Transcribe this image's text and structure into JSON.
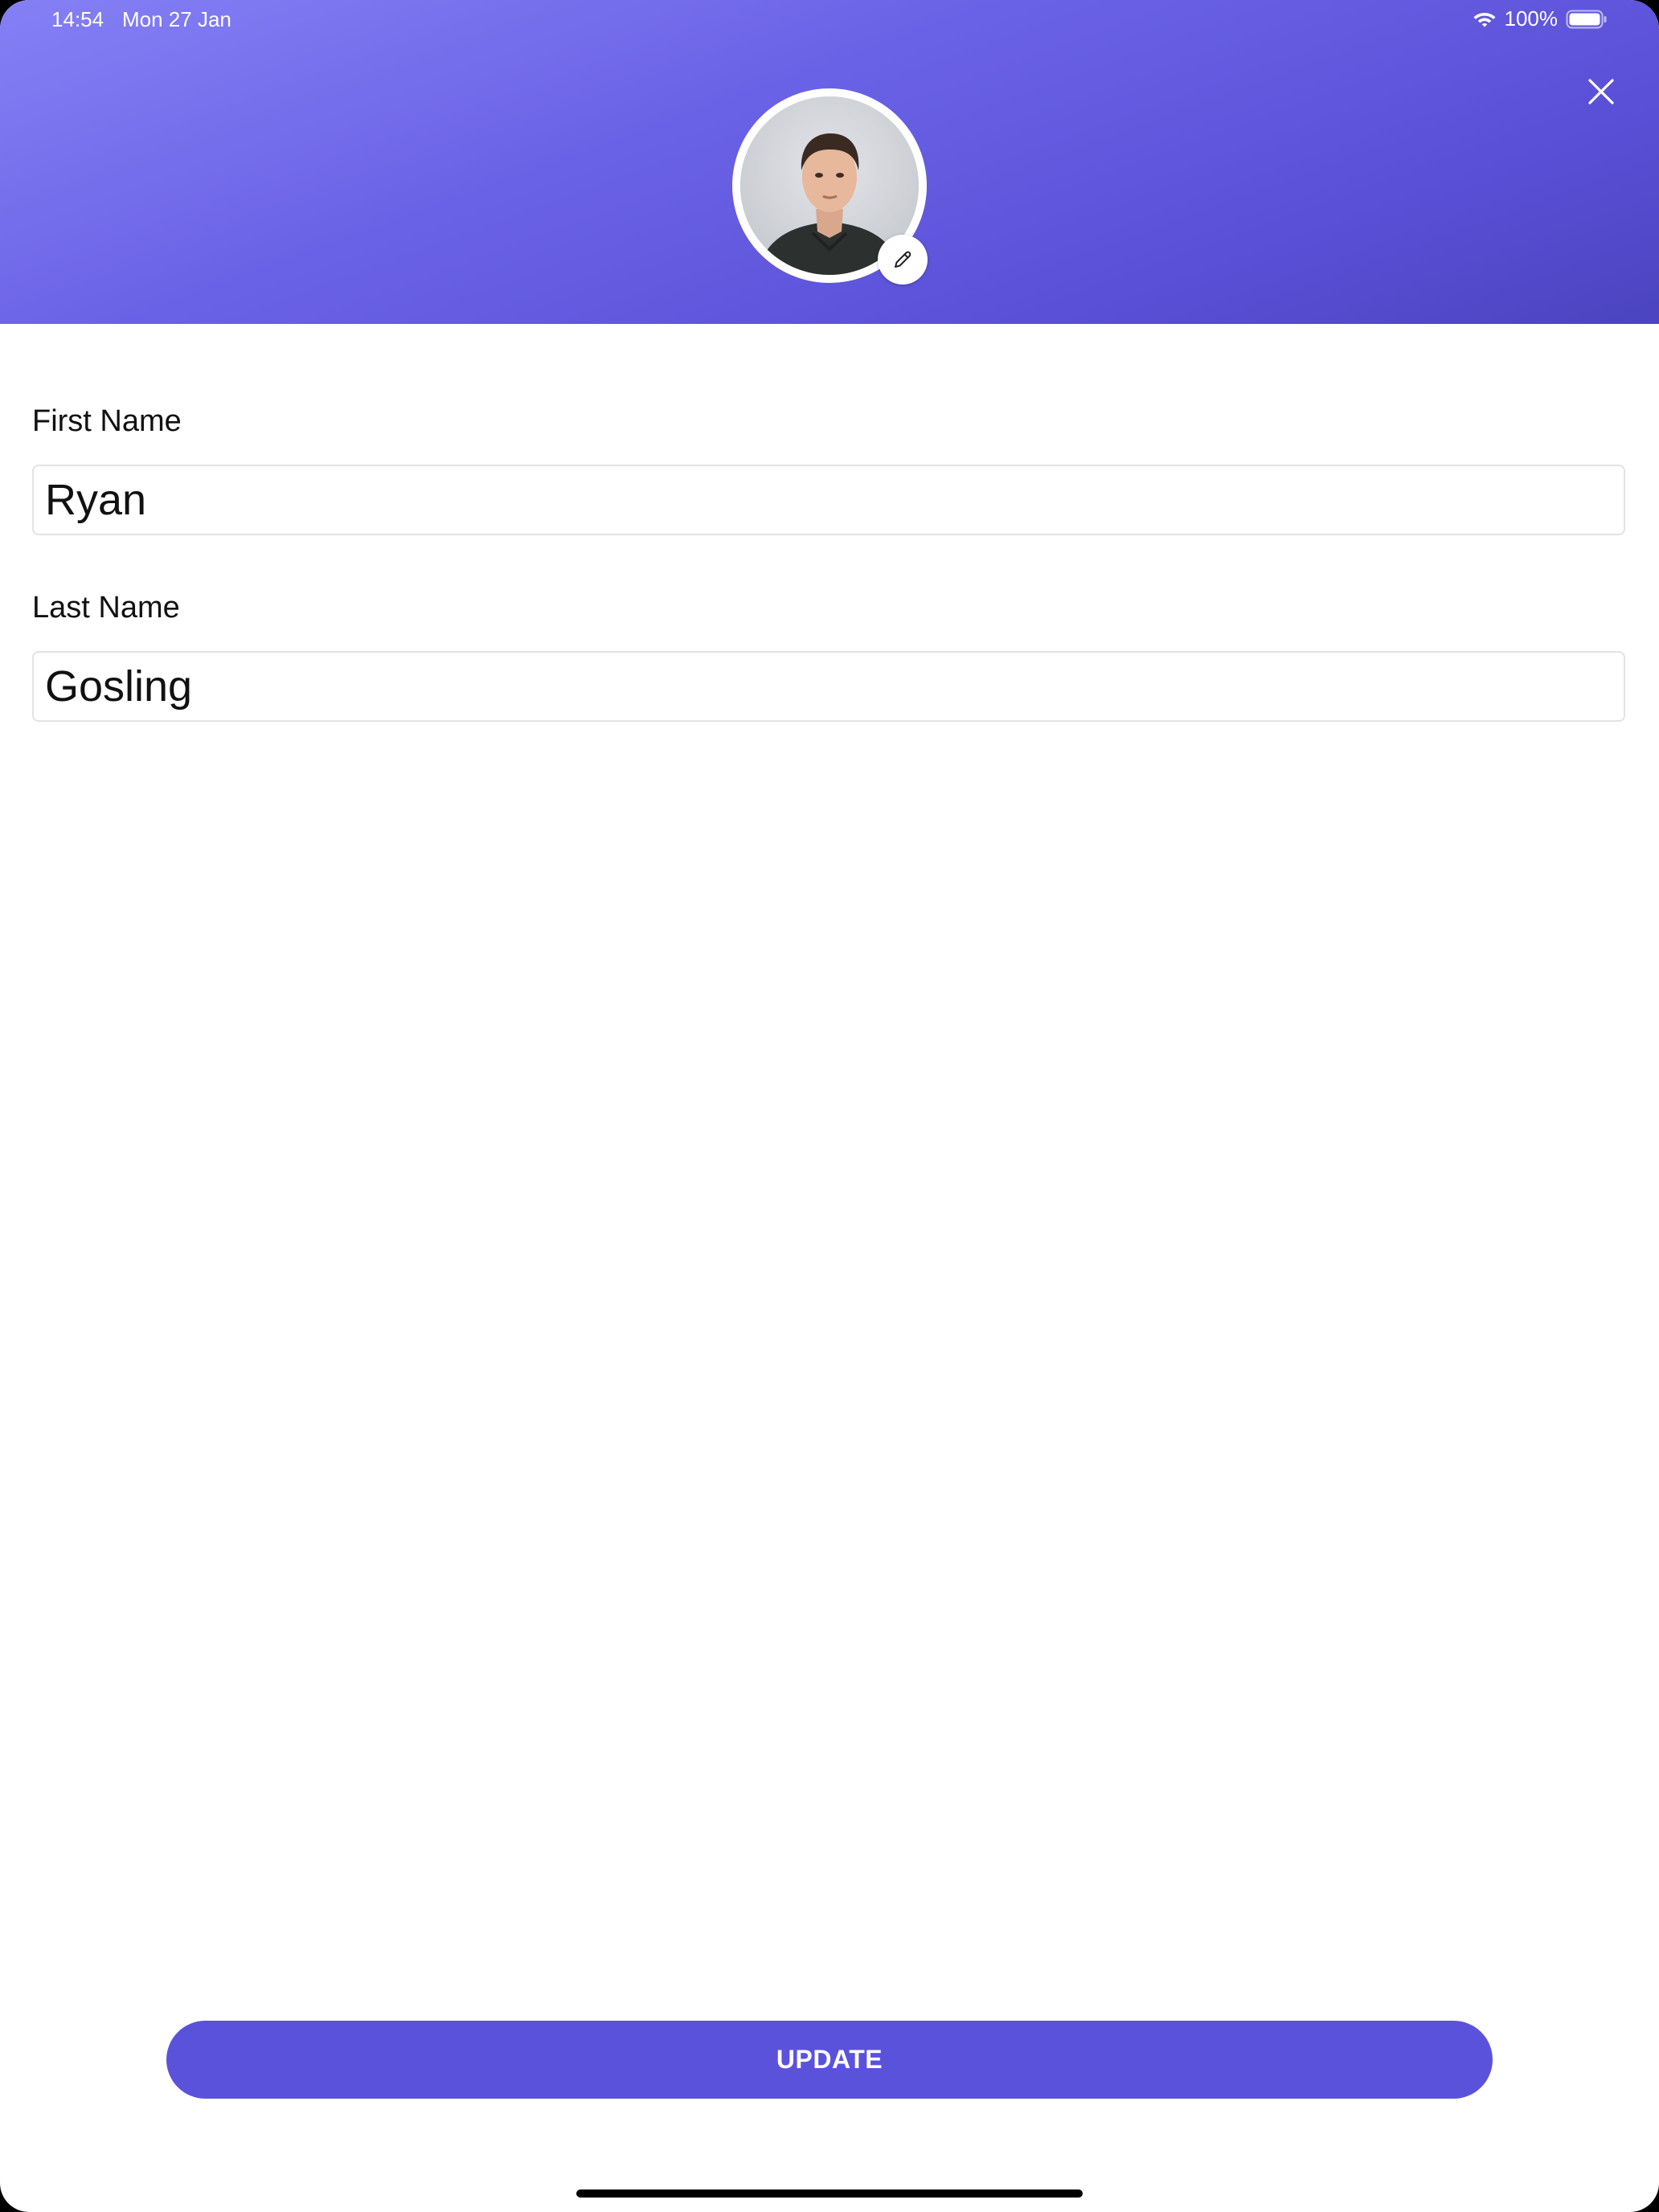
{
  "status_bar": {
    "time": "14:54",
    "date": "Mon 27 Jan",
    "battery": "100%"
  },
  "header": {
    "close_icon": "close-icon",
    "edit_icon": "pencil-icon",
    "gradient_start": "#8580f5",
    "gradient_end": "#4b44bf"
  },
  "form": {
    "first_name": {
      "label": "First Name",
      "value": "Ryan"
    },
    "last_name": {
      "label": "Last Name",
      "value": "Gosling"
    }
  },
  "update_button": {
    "label": "UPDATE",
    "color": "#5b52dc"
  }
}
